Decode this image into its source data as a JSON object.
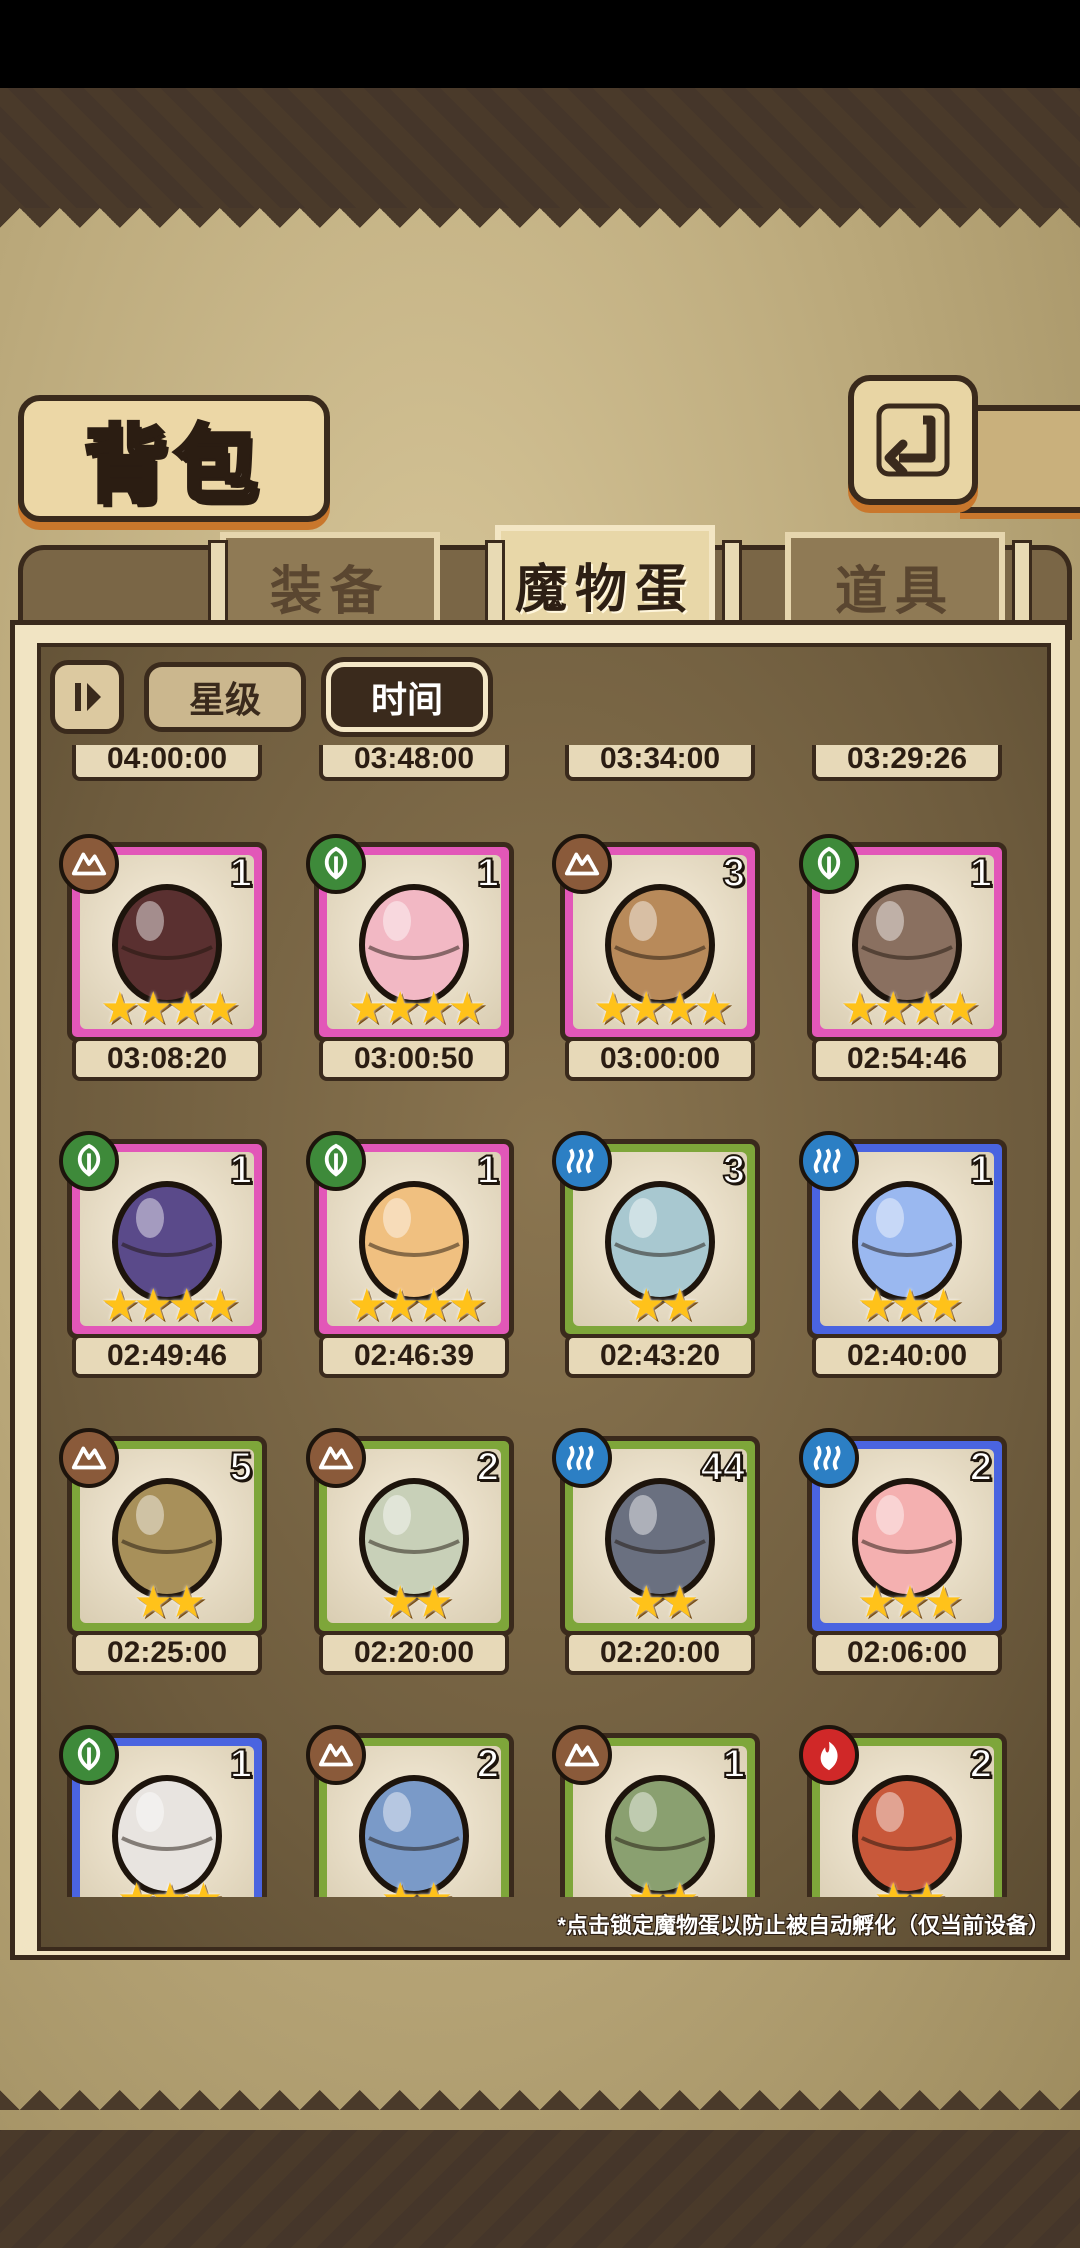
{
  "screen": {
    "title": "背包",
    "back_icon": "return-arrow-icon"
  },
  "tabs": [
    {
      "label": "装备",
      "active": false
    },
    {
      "label": "魔物蛋",
      "active": true
    },
    {
      "label": "道具",
      "active": false
    }
  ],
  "sort": {
    "toggle_icon": "sort-direction-icon",
    "options": [
      {
        "label": "星级",
        "active": false
      },
      {
        "label": "时间",
        "active": true
      }
    ]
  },
  "colors": {
    "rarity_purple": "#e257b8",
    "rarity_green": "#7ea63a",
    "rarity_blue": "#4a64e0",
    "element_earth": "#8a5a3a",
    "element_wood": "#3e8a3a",
    "element_water": "#2c7fc4",
    "element_fire": "#d02828",
    "star": "#ffc21a"
  },
  "top_timers": [
    "04:00:00",
    "03:48:00",
    "03:34:00",
    "03:29:26"
  ],
  "eggs": [
    {
      "element": "earth",
      "element_icon": "mountain-icon",
      "rarity": "purple",
      "count": "1",
      "stars": 4,
      "timer": "03:08:20",
      "egg_icon": "horn-egg-icon",
      "egg_color": "#5a3030"
    },
    {
      "element": "wood",
      "element_icon": "leaf-icon",
      "rarity": "purple",
      "count": "1",
      "stars": 4,
      "timer": "03:00:50",
      "egg_icon": "pink-bunny-egg-icon",
      "egg_color": "#f2b8c4"
    },
    {
      "element": "earth",
      "element_icon": "mountain-icon",
      "rarity": "purple",
      "count": "3",
      "stars": 4,
      "timer": "03:00:00",
      "egg_icon": "raccoon-egg-icon",
      "egg_color": "#b88a5a"
    },
    {
      "element": "wood",
      "element_icon": "leaf-icon",
      "rarity": "purple",
      "count": "1",
      "stars": 4,
      "timer": "02:54:46",
      "egg_icon": "striped-egg-icon",
      "egg_color": "#8a7060"
    },
    {
      "element": "wood",
      "element_icon": "leaf-icon",
      "rarity": "purple",
      "count": "1",
      "stars": 4,
      "timer": "02:49:46",
      "egg_icon": "moth-egg-icon",
      "egg_color": "#5a4a8a"
    },
    {
      "element": "wood",
      "element_icon": "leaf-icon",
      "rarity": "purple",
      "count": "1",
      "stars": 4,
      "timer": "02:46:39",
      "egg_icon": "feather-egg-icon",
      "egg_color": "#f0c080"
    },
    {
      "element": "water",
      "element_icon": "water-icon",
      "rarity": "green",
      "count": "3",
      "stars": 2,
      "timer": "02:43:20",
      "egg_icon": "stone-egg-icon",
      "egg_color": "#a8c8d0"
    },
    {
      "element": "water",
      "element_icon": "water-icon",
      "rarity": "blue",
      "count": "1",
      "stars": 3,
      "timer": "02:40:00",
      "egg_icon": "crystal-egg-icon",
      "egg_color": "#9ab8f0"
    },
    {
      "element": "earth",
      "element_icon": "mountain-icon",
      "rarity": "green",
      "count": "5",
      "stars": 2,
      "timer": "02:25:00",
      "egg_icon": "wrapped-egg-icon",
      "egg_color": "#a8905a"
    },
    {
      "element": "earth",
      "element_icon": "mountain-icon",
      "rarity": "green",
      "count": "2",
      "stars": 2,
      "timer": "02:20:00",
      "egg_icon": "spotted-egg-icon",
      "egg_color": "#c8d0b8"
    },
    {
      "element": "water",
      "element_icon": "water-icon",
      "rarity": "green",
      "count": "44",
      "stars": 2,
      "timer": "02:20:00",
      "egg_icon": "shell-egg-icon",
      "egg_color": "#6a7080"
    },
    {
      "element": "water",
      "element_icon": "water-icon",
      "rarity": "blue",
      "count": "2",
      "stars": 3,
      "timer": "02:06:00",
      "egg_icon": "peach-egg-icon",
      "egg_color": "#f4b0b0"
    },
    {
      "element": "wood",
      "element_icon": "leaf-icon",
      "rarity": "blue",
      "count": "1",
      "stars": 3,
      "timer": "",
      "egg_icon": "spiked-egg-icon",
      "egg_color": "#e8e4e0"
    },
    {
      "element": "earth",
      "element_icon": "mountain-icon",
      "rarity": "green",
      "count": "2",
      "stars": 2,
      "timer": "",
      "egg_icon": "fish-egg-icon",
      "egg_color": "#7a9ac8"
    },
    {
      "element": "earth",
      "element_icon": "mountain-icon",
      "rarity": "green",
      "count": "1",
      "stars": 2,
      "timer": "",
      "egg_icon": "sprout-egg-icon",
      "egg_color": "#8aa070"
    },
    {
      "element": "fire",
      "element_icon": "flame-icon",
      "rarity": "green",
      "count": "2",
      "stars": 2,
      "timer": "",
      "egg_icon": "lava-egg-icon",
      "egg_color": "#c8583a"
    }
  ],
  "footer_note": "*点击锁定魔物蛋以防止被自动孵化（仅当前设备）"
}
